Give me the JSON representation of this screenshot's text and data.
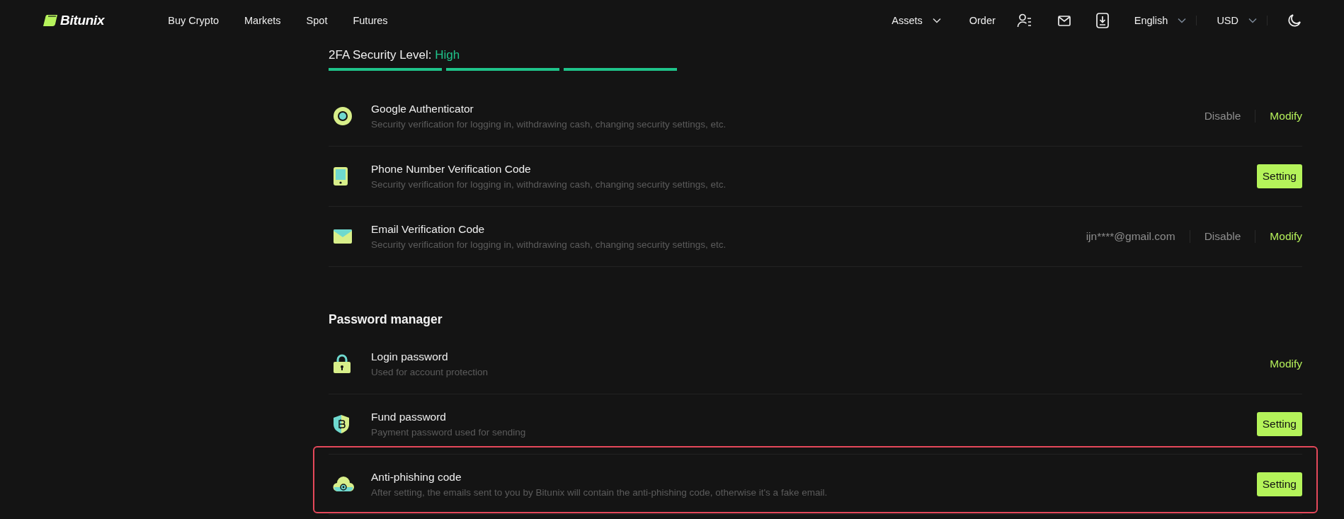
{
  "header": {
    "logo": "Bitunix",
    "nav": [
      {
        "label": "Buy Crypto"
      },
      {
        "label": "Markets"
      },
      {
        "label": "Spot"
      },
      {
        "label": "Futures"
      }
    ],
    "right": [
      {
        "kind": "menu",
        "label": "Assets"
      },
      {
        "kind": "link",
        "label": "Order"
      },
      {
        "kind": "icon"
      },
      {
        "kind": "icon"
      },
      {
        "kind": "icon"
      },
      {
        "kind": "select",
        "label": "English"
      },
      {
        "kind": "select",
        "label": "USD"
      },
      {
        "kind": "icon"
      }
    ]
  },
  "security_level": {
    "label": "2FA Security Level:",
    "value": "High",
    "segments": [
      {
        "filled": true
      },
      {
        "filled": true
      },
      {
        "filled": true
      }
    ]
  },
  "sections": [
    {
      "items": [
        {
          "title": "Google Authenticator",
          "description": "Security verification for logging in, withdrawing cash, changing security settings, etc.",
          "highlighted": false,
          "actions": [
            {
              "kind": "text",
              "label": "Disable"
            },
            {
              "kind": "link",
              "label": "Modify"
            }
          ]
        },
        {
          "title": "Phone Number Verification Code",
          "description": "Security verification for logging in, withdrawing cash, changing security settings, etc.",
          "highlighted": false,
          "actions": [
            {
              "kind": "button",
              "label": "Setting"
            }
          ]
        },
        {
          "title": "Email Verification Code",
          "description": "Security verification for logging in, withdrawing cash, changing security settings, etc.",
          "highlighted": false,
          "actions": [
            {
              "kind": "info",
              "label": "ijn****@gmail.com"
            },
            {
              "kind": "text",
              "label": "Disable"
            },
            {
              "kind": "link",
              "label": "Modify"
            }
          ]
        }
      ]
    },
    {
      "title": "Password manager",
      "items": [
        {
          "title": "Login password",
          "description": "Used for account protection",
          "highlighted": false,
          "actions": [
            {
              "kind": "link",
              "label": "Modify"
            }
          ]
        },
        {
          "title": "Fund password",
          "description": "Payment password used for sending",
          "highlighted": false,
          "actions": [
            {
              "kind": "button",
              "label": "Setting"
            }
          ]
        },
        {
          "title": "Anti-phishing code",
          "description": "After setting, the emails sent to you by Bitunix will contain the anti-phishing code, otherwise it's a fake email.",
          "highlighted": true,
          "actions": [
            {
              "kind": "button",
              "label": "Setting"
            }
          ]
        }
      ]
    }
  ]
}
